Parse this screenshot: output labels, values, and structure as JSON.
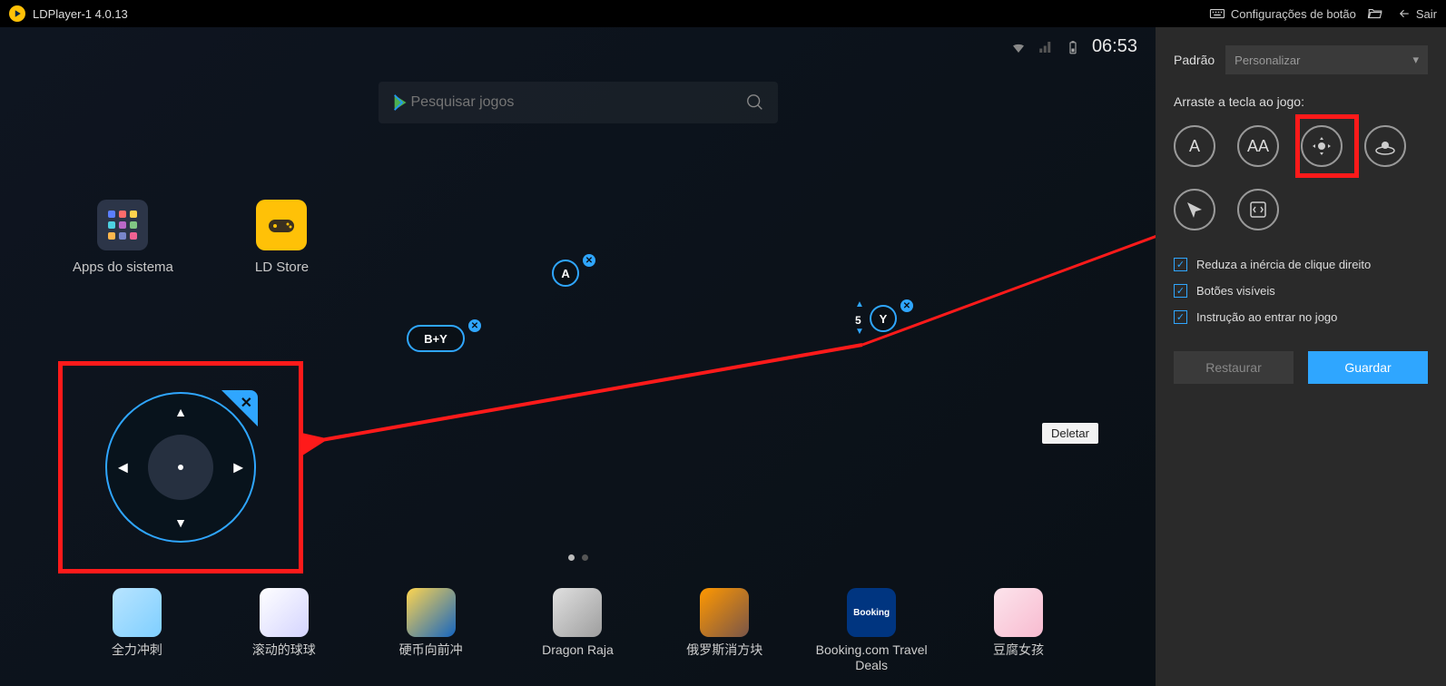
{
  "titlebar": {
    "title": "LDPlayer-1 4.0.13",
    "config_label": "Configurações de botão",
    "exit_label": "Sair"
  },
  "statusbar": {
    "clock": "06:53"
  },
  "search": {
    "placeholder": "Pesquisar jogos"
  },
  "home_apps": {
    "system": "Apps do sistema",
    "store": "LD Store"
  },
  "keys": {
    "a": "A",
    "by": "B+Y",
    "y": "Y",
    "y_num": "5"
  },
  "deletar": "Deletar",
  "dock": [
    "全力冲刺",
    "滚动的球球",
    "硬币向前冲",
    "Dragon Raja",
    "俄罗斯消方块",
    "Booking.com Travel Deals",
    "豆腐女孩"
  ],
  "sidebar": {
    "mode_label": "Padrão",
    "mode_value": "Personalizar",
    "drag_title": "Arraste a tecla ao jogo:",
    "key_labels": {
      "single": "A",
      "double": "AA"
    },
    "checks": {
      "inertia": "Reduza a inércia de clique direito",
      "visible": "Botões visíveis",
      "instruction": "Instrução ao entrar no jogo"
    },
    "restore": "Restaurar",
    "save": "Guardar"
  }
}
